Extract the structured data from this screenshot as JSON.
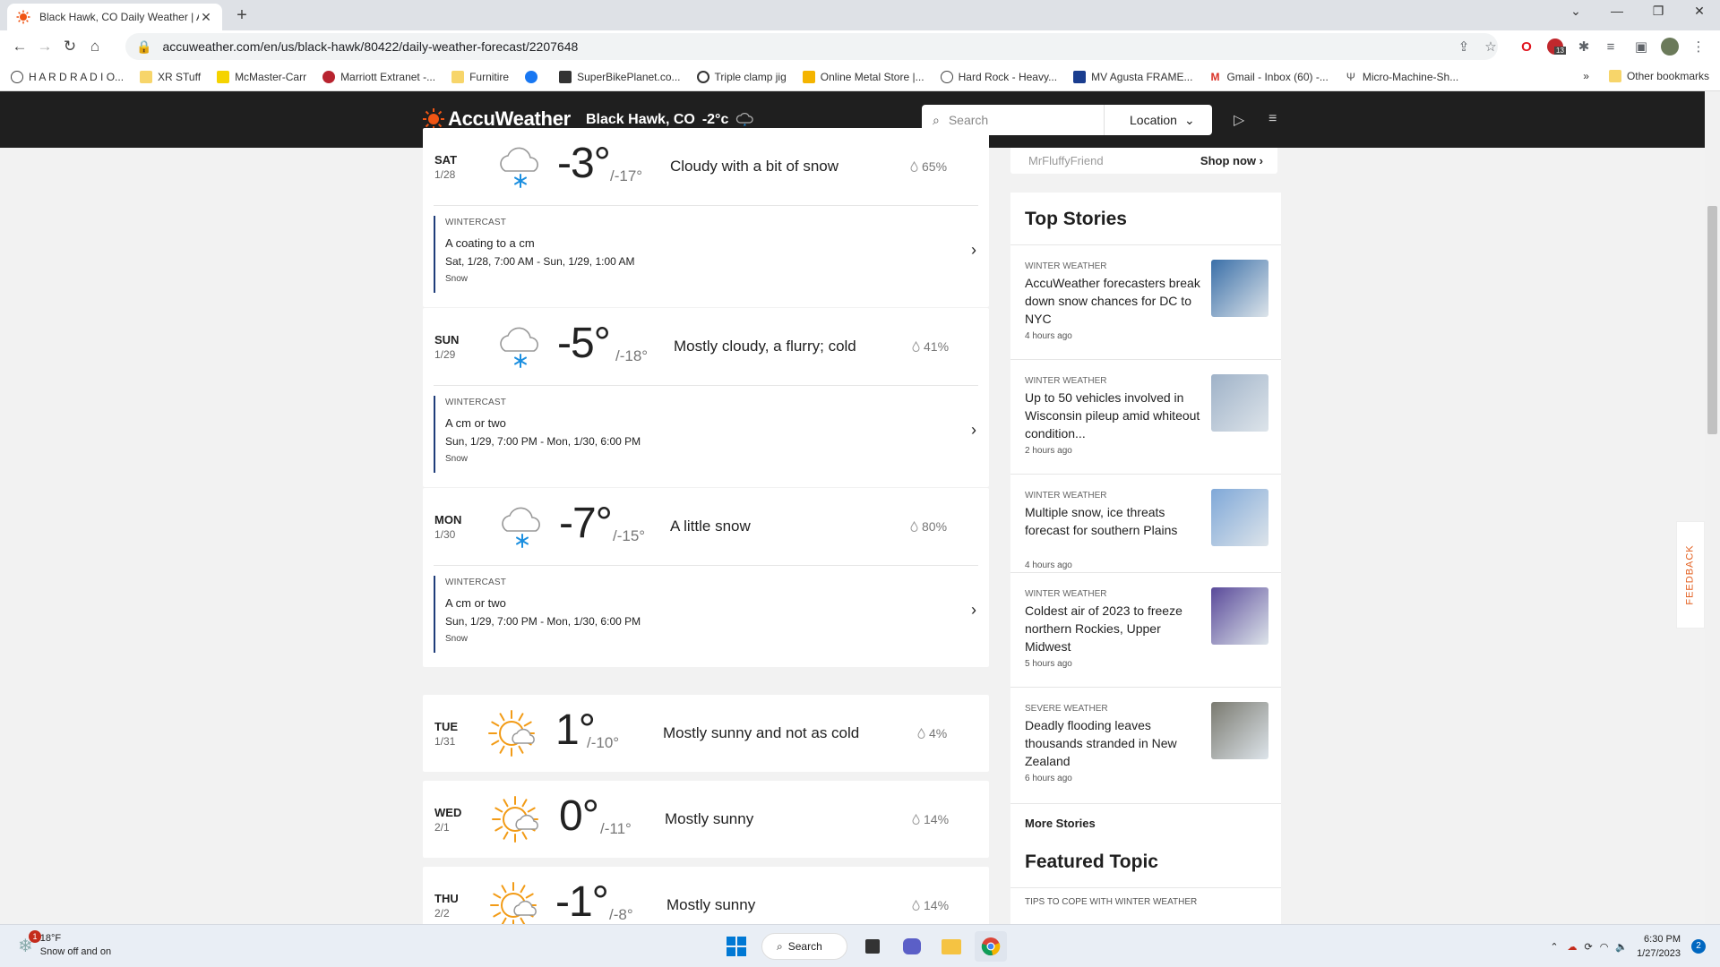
{
  "browser": {
    "tab_title": "Black Hawk, CO Daily Weather | A",
    "url": "accuweather.com/en/us/black-hawk/80422/daily-weather-forecast/2207648",
    "bookmarks": [
      {
        "label": "H A R D R A D I O..."
      },
      {
        "label": "XR STuff"
      },
      {
        "label": "McMaster-Carr"
      },
      {
        "label": "Marriott Extranet -..."
      },
      {
        "label": "Furnitire"
      },
      {
        "label": ""
      },
      {
        "label": "SuperBikePlanet.co..."
      },
      {
        "label": "Triple clamp jig"
      },
      {
        "label": "Online Metal Store |..."
      },
      {
        "label": "Hard Rock - Heavy..."
      },
      {
        "label": "MV Agusta FRAME..."
      },
      {
        "label": "Gmail - Inbox (60) -..."
      },
      {
        "label": "Micro-Machine-Sh..."
      }
    ],
    "other_bookmarks": "Other bookmarks",
    "ext_badge": "13"
  },
  "header": {
    "logo": "AccuWeather",
    "location": "Black Hawk, CO",
    "temp": "-2°c",
    "search_placeholder": "Search",
    "location_btn": "Location"
  },
  "forecast": [
    {
      "day": "SAT",
      "date": "1/28",
      "icon": "cloud-snow-icon",
      "hi": "-3°",
      "lo": "/-17°",
      "phrase": "Cloudy with a bit of snow",
      "precip": "65%",
      "wintercast": {
        "label": "WINTERCAST",
        "amount": "A coating to a cm",
        "time": "Sat, 1/28, 7:00 AM - Sun, 1/29, 1:00 AM",
        "type": "Snow"
      }
    },
    {
      "day": "SUN",
      "date": "1/29",
      "icon": "cloud-snow-icon",
      "hi": "-5°",
      "lo": "/-18°",
      "phrase": "Mostly cloudy, a flurry; cold",
      "precip": "41%",
      "wintercast": {
        "label": "WINTERCAST",
        "amount": "A cm or two",
        "time": "Sun, 1/29, 7:00 PM - Mon, 1/30, 6:00 PM",
        "type": "Snow"
      }
    },
    {
      "day": "MON",
      "date": "1/30",
      "icon": "cloud-snow-icon",
      "hi": "-7°",
      "lo": "/-15°",
      "phrase": "A little snow",
      "precip": "80%",
      "wintercast": {
        "label": "WINTERCAST",
        "amount": "A cm or two",
        "time": "Sun, 1/29, 7:00 PM - Mon, 1/30, 6:00 PM",
        "type": "Snow"
      }
    },
    {
      "day": "TUE",
      "date": "1/31",
      "icon": "sun-cloud-icon",
      "hi": "1°",
      "lo": "/-10°",
      "phrase": "Mostly sunny and not as cold",
      "precip": "4%"
    },
    {
      "day": "WED",
      "date": "2/1",
      "icon": "sun-cloud-icon",
      "hi": "0°",
      "lo": "/-11°",
      "phrase": "Mostly sunny",
      "precip": "14%"
    },
    {
      "day": "THU",
      "date": "2/2",
      "icon": "sun-cloud-icon",
      "hi": "-1°",
      "lo": "/-8°",
      "phrase": "Mostly sunny",
      "precip": "14%"
    }
  ],
  "sidebar": {
    "ad_source": "MrFluffyFriend",
    "ad_cta": "Shop now",
    "top_stories_title": "Top Stories",
    "stories": [
      {
        "category": "WINTER WEATHER",
        "headline": "AccuWeather forecasters break down snow chances for DC to NYC",
        "age": "4 hours ago",
        "thumb_color": "#3a6fa8"
      },
      {
        "category": "WINTER WEATHER",
        "headline": "Up to 50 vehicles involved in Wisconsin pileup amid whiteout condition...",
        "age": "2 hours ago",
        "thumb_color": "#9fb2c8"
      },
      {
        "category": "WINTER WEATHER",
        "headline": "Multiple snow, ice threats forecast for southern Plains",
        "age": "4 hours ago",
        "thumb_color": "#7fa8d8"
      },
      {
        "category": "WINTER WEATHER",
        "headline": "Coldest air of 2023 to freeze northern Rockies, Upper Midwest",
        "age": "5 hours ago",
        "thumb_color": "#5a4a9a"
      },
      {
        "category": "SEVERE WEATHER",
        "headline": "Deadly flooding leaves thousands stranded in New Zealand",
        "age": "6 hours ago",
        "thumb_color": "#7a7a70"
      }
    ],
    "more_stories": "More Stories",
    "featured_topic": "Featured Topic",
    "featured_sub": "TIPS TO COPE WITH WINTER WEATHER"
  },
  "feedback": "FEEDBACK",
  "taskbar": {
    "weather_temp": "18°F",
    "weather_desc": "Snow off and on",
    "weather_badge": "1",
    "search": "Search",
    "time": "6:30 PM",
    "date": "1/27/2023",
    "notif": "2"
  },
  "colors": {
    "accent": "#f05514",
    "header_bg": "#1f1f1f",
    "wintercast_bar": "#1f3d7a",
    "snow_blue": "#1b8fe0",
    "sun_orange": "#f29b16"
  }
}
